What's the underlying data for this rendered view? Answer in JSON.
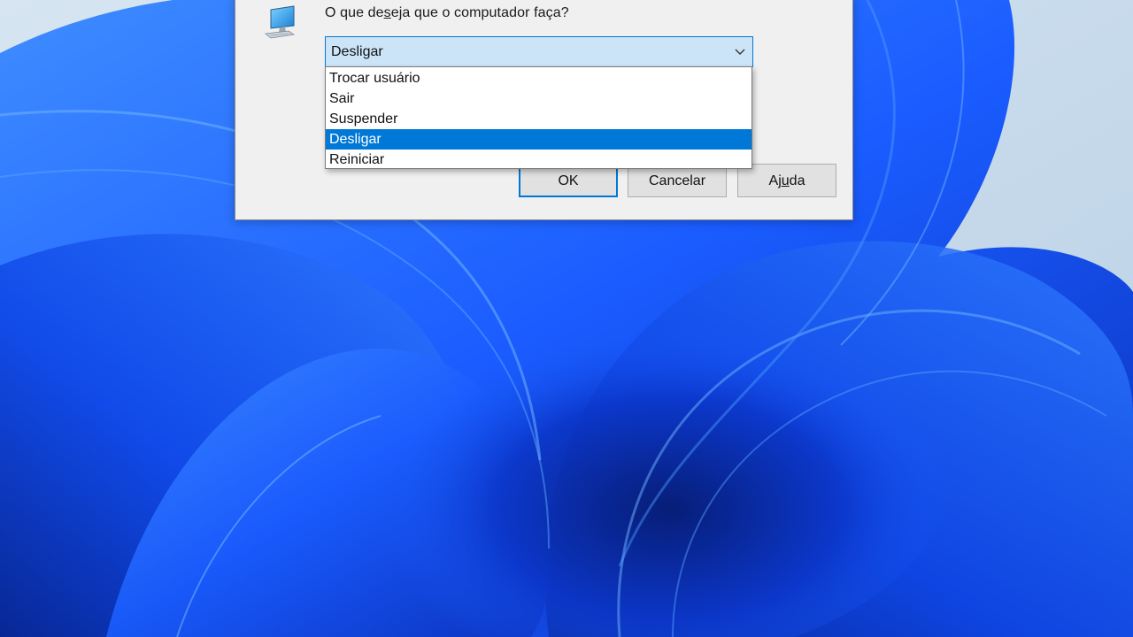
{
  "dialog": {
    "prompt_pre": "O que de",
    "prompt_underlined": "s",
    "prompt_post": "eja que o computador faça?",
    "selected_value": "Desligar",
    "options": [
      {
        "label": "Trocar usuário",
        "selected": false
      },
      {
        "label": "Sair",
        "selected": false
      },
      {
        "label": "Suspender",
        "selected": false
      },
      {
        "label": "Desligar",
        "selected": true
      },
      {
        "label": "Reiniciar",
        "selected": false
      }
    ],
    "buttons": {
      "ok_label": "OK",
      "cancel_label": "Cancelar",
      "help_pre": "Aj",
      "help_underlined": "u",
      "help_post": "da"
    },
    "icon": "computer-icon"
  },
  "colors": {
    "accent": "#0078d7",
    "combo_background": "#cce4f7",
    "dialog_background": "#f0f0f0",
    "wallpaper_primary": "#1a5cff",
    "wallpaper_background": "#cfe0ee"
  }
}
